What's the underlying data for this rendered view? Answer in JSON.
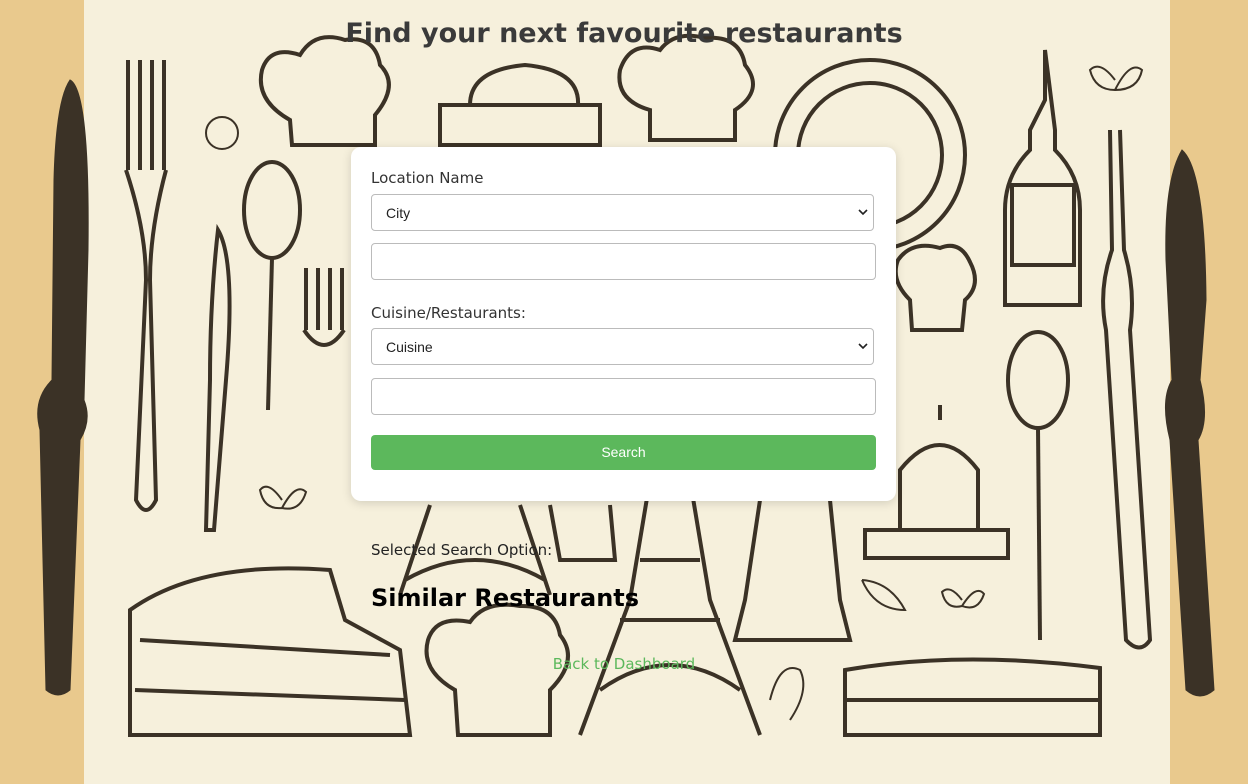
{
  "page": {
    "title": "Find your next favourite restaurants"
  },
  "form": {
    "location_label": "Location Name",
    "location_select": "City",
    "location_input": "",
    "cuisine_label": "Cuisine/Restaurants:",
    "cuisine_select": "Cuisine",
    "cuisine_input": "",
    "search_button": "Search"
  },
  "results": {
    "selected_option_label": "Selected Search Option:",
    "similar_heading": "Similar Restaurants"
  },
  "footer": {
    "back_link": "Back to Dashboard"
  },
  "colors": {
    "accent": "#5cb85c",
    "page_bg": "#f6f0dc",
    "side_bg": "#e9c98d",
    "ink": "#3b3226"
  }
}
